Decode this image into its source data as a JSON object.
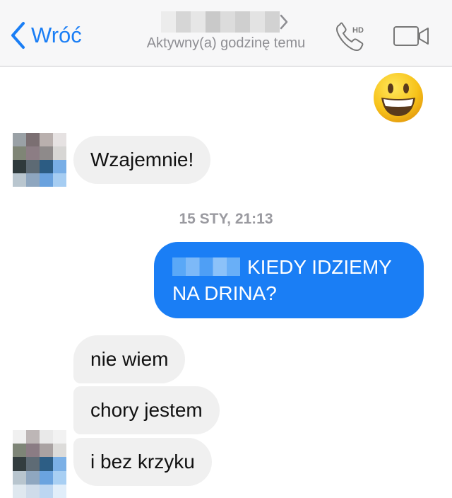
{
  "header": {
    "back_label": "Wróć",
    "status": "Aktywny(a) godzinę temu",
    "call_badge": "HD",
    "icons": [
      "chevron-left-icon",
      "chevron-right-icon",
      "phone-icon",
      "video-camera-icon"
    ]
  },
  "messages": {
    "received_1": "Wzajemnie!",
    "timestamp": "15 STY, 21:13",
    "sent_1": "KIEDY IDZIEMY NA DRINA?",
    "received_2": "nie wiem",
    "received_3": "chory jestem",
    "received_4": "i bez krzyku"
  },
  "colors": {
    "accent": "#1a7ef5",
    "incoming_bubble": "#f0f0f0",
    "header_bg": "#f7f7f8",
    "secondary_text": "#8e8e93"
  }
}
